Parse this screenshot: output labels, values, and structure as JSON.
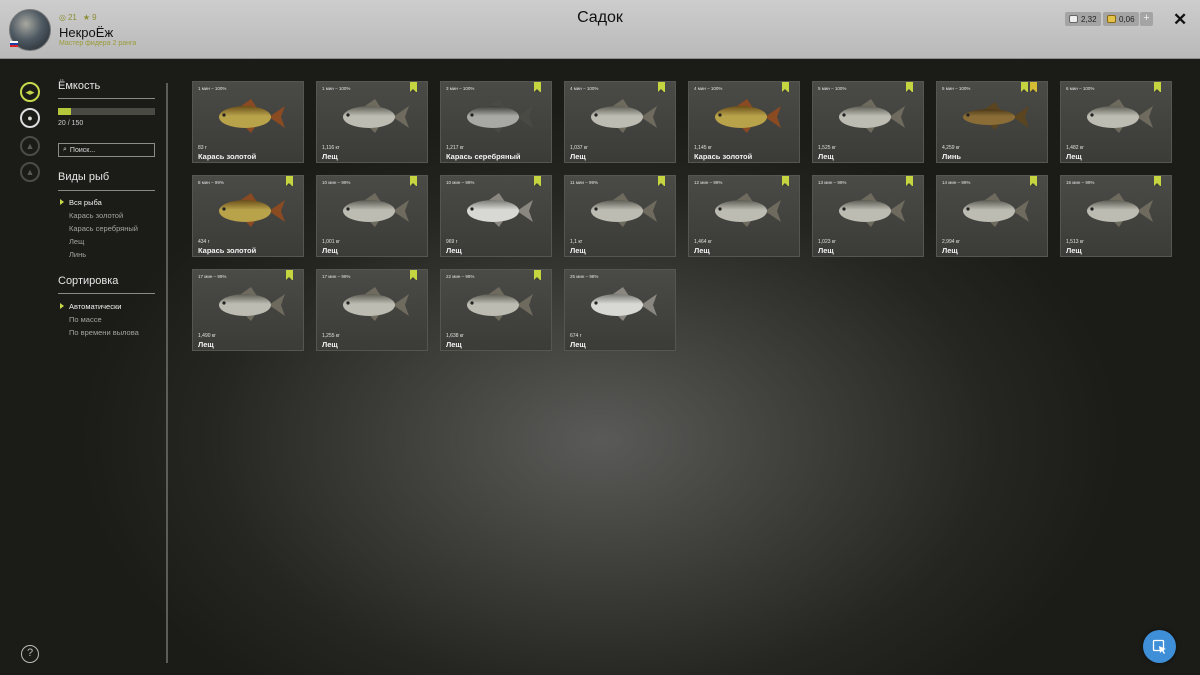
{
  "header": {
    "player_name": "НекроЁж",
    "player_title": "Мастер фидера 2 ранга",
    "level": "21",
    "rank": "9",
    "page_title": "Садок",
    "silver": "2,32",
    "gold": "0,06",
    "plus_label": "+",
    "close_label": "✕"
  },
  "sidebar": {
    "capacity_title": "Ёмкость",
    "capacity_text": "20 / 150",
    "capacity_fraction": 0.133,
    "search_placeholder": "Поиск...",
    "species_title": "Виды рыб",
    "species": [
      "Вся рыба",
      "Карась золотой",
      "Карась серебряный",
      "Лещ",
      "Линь"
    ],
    "sort_title": "Сортировка",
    "sort_options": [
      "Автоматически",
      "По массе",
      "По времени вылова"
    ]
  },
  "fish": [
    {
      "meta": "1 мин – 100%",
      "weight": "83 г",
      "name": "Карась золотой",
      "kind": "goldcrucian",
      "marks": []
    },
    {
      "meta": "1 мин – 100%",
      "weight": "1,116 кг",
      "name": "Лещ",
      "kind": "bream",
      "marks": [
        "green"
      ]
    },
    {
      "meta": "3 мин – 100%",
      "weight": "1,217 кг",
      "name": "Карась серебряный",
      "kind": "silvercrucian",
      "marks": [
        "green"
      ]
    },
    {
      "meta": "4 мин – 100%",
      "weight": "1,037 кг",
      "name": "Лещ",
      "kind": "bream",
      "marks": [
        "green"
      ]
    },
    {
      "meta": "4 мин – 100%",
      "weight": "1,145 кг",
      "name": "Карась золотой",
      "kind": "goldcrucian",
      "marks": [
        "green"
      ]
    },
    {
      "meta": "5 мин – 100%",
      "weight": "1,525 кг",
      "name": "Лещ",
      "kind": "bream",
      "marks": [
        "green"
      ]
    },
    {
      "meta": "5 мин – 100%",
      "weight": "4,259 кг",
      "name": "Линь",
      "kind": "tench",
      "marks": [
        "green",
        "gold"
      ]
    },
    {
      "meta": "6 мин – 100%",
      "weight": "1,482 кг",
      "name": "Лещ",
      "kind": "bream",
      "marks": [
        "green"
      ]
    },
    {
      "meta": "8 мин – 99%",
      "weight": "434 г",
      "name": "Карась золотой",
      "kind": "goldcrucian",
      "marks": [
        "green"
      ]
    },
    {
      "meta": "10 мин – 99%",
      "weight": "1,001 кг",
      "name": "Лещ",
      "kind": "bream",
      "marks": [
        "green"
      ]
    },
    {
      "meta": "10 мин – 99%",
      "weight": "969 г",
      "name": "Лещ",
      "kind": "brightbream",
      "marks": [
        "green"
      ]
    },
    {
      "meta": "11 мин – 99%",
      "weight": "1,1 кг",
      "name": "Лещ",
      "kind": "bream",
      "marks": [
        "green"
      ]
    },
    {
      "meta": "12 мин – 99%",
      "weight": "1,464 кг",
      "name": "Лещ",
      "kind": "bream",
      "marks": [
        "green"
      ]
    },
    {
      "meta": "13 мин – 99%",
      "weight": "1,023 кг",
      "name": "Лещ",
      "kind": "bream",
      "marks": [
        "green"
      ]
    },
    {
      "meta": "14 мин – 99%",
      "weight": "2,994 кг",
      "name": "Лещ",
      "kind": "bream",
      "marks": [
        "green"
      ]
    },
    {
      "meta": "16 мин – 99%",
      "weight": "1,513 кг",
      "name": "Лещ",
      "kind": "bream",
      "marks": [
        "green"
      ]
    },
    {
      "meta": "17 мин – 99%",
      "weight": "1,490 кг",
      "name": "Лещ",
      "kind": "bream",
      "marks": [
        "green"
      ]
    },
    {
      "meta": "17 мин – 99%",
      "weight": "1,255 кг",
      "name": "Лещ",
      "kind": "bream",
      "marks": [
        "green"
      ]
    },
    {
      "meta": "22 мин – 98%",
      "weight": "1,638 кг",
      "name": "Лещ",
      "kind": "bream",
      "marks": [
        "green"
      ]
    },
    {
      "meta": "25 мин – 98%",
      "weight": "674 г",
      "name": "Лещ",
      "kind": "brightbream",
      "marks": []
    }
  ],
  "fish_colors": {
    "bream": {
      "body": "#bcbcb2",
      "dark": "#5d5d55",
      "fin": "#6f6a5e"
    },
    "brightbream": {
      "body": "#d8d8d4",
      "dark": "#7a7a74",
      "fin": "#8a8680"
    },
    "goldcrucian": {
      "body": "#b8a24a",
      "dark": "#6a4e1a",
      "fin": "#8a4a22"
    },
    "silvercrucian": {
      "body": "#a8a8a4",
      "dark": "#3a3a36",
      "fin": "#4a4a45"
    },
    "tench": {
      "body": "#8a6d36",
      "dark": "#4b3818",
      "fin": "#5a4520"
    }
  },
  "accent_color": "#c5d53f"
}
